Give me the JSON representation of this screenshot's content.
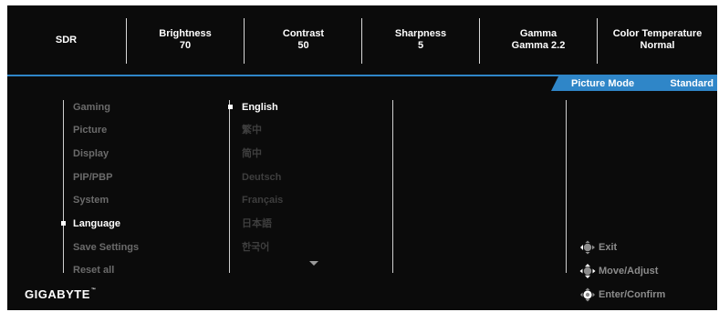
{
  "status": [
    {
      "label": "SDR",
      "value": ""
    },
    {
      "label": "Brightness",
      "value": "70"
    },
    {
      "label": "Contrast",
      "value": "50"
    },
    {
      "label": "Sharpness",
      "value": "5"
    },
    {
      "label": "Gamma",
      "value": "Gamma 2.2"
    },
    {
      "label": "Color Temperature",
      "value": "Normal"
    }
  ],
  "picture_mode": {
    "label": "Picture Mode",
    "value": "Standard"
  },
  "menu": {
    "items": [
      {
        "label": "Gaming"
      },
      {
        "label": "Picture"
      },
      {
        "label": "Display"
      },
      {
        "label": "PIP/PBP"
      },
      {
        "label": "System"
      },
      {
        "label": "Language"
      },
      {
        "label": "Save Settings"
      },
      {
        "label": "Reset all"
      }
    ],
    "selected_index": 5
  },
  "languages": {
    "items": [
      {
        "label": "English"
      },
      {
        "label": "繁中"
      },
      {
        "label": "简中"
      },
      {
        "label": "Deutsch"
      },
      {
        "label": "Français"
      },
      {
        "label": "日本語"
      },
      {
        "label": "한국어"
      }
    ],
    "selected_index": 0
  },
  "hints": [
    {
      "label": "Exit",
      "icon": "joystick-left-icon"
    },
    {
      "label": "Move/Adjust",
      "icon": "joystick-up-icon"
    },
    {
      "label": "Enter/Confirm",
      "icon": "joystick-press-icon"
    }
  ],
  "brand": {
    "name": "GIGABYTE",
    "tm": "™"
  },
  "colors": {
    "accent": "#2f86c8",
    "background": "#0b0b0b",
    "text": "#ffffff",
    "inactive": "#6b6b6b"
  }
}
